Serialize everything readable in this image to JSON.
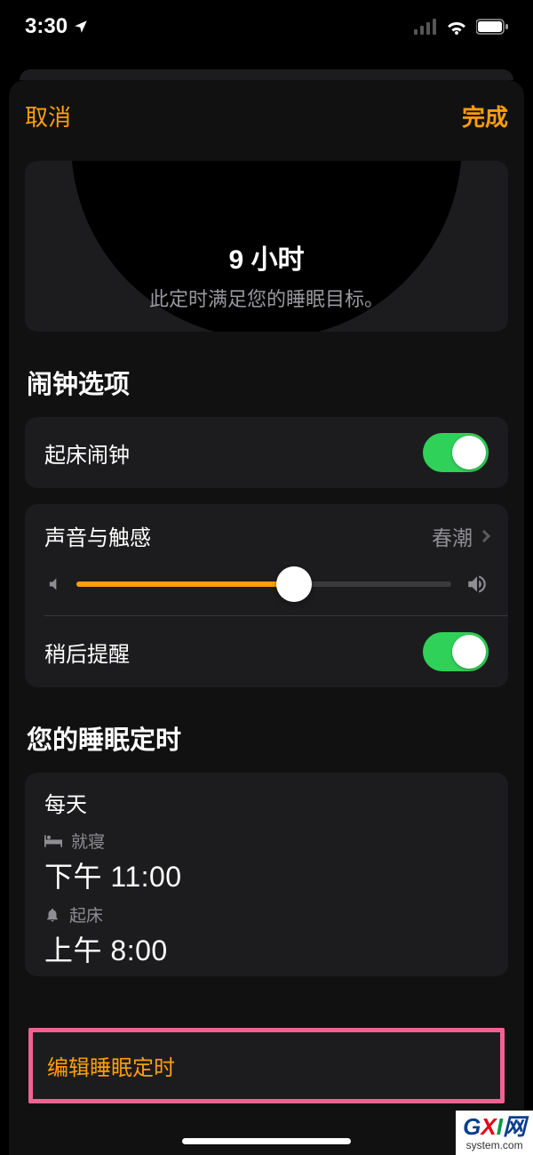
{
  "status": {
    "time": "3:30"
  },
  "nav": {
    "cancel": "取消",
    "done": "完成"
  },
  "summary": {
    "title": "9 小时",
    "subtitle": "此定时满足您的睡眠目标。"
  },
  "alarm_section": {
    "title": "闹钟选项",
    "wake_alarm_label": "起床闹钟",
    "sound_label": "声音与触感",
    "sound_value": "春潮",
    "snooze_label": "稍后提醒"
  },
  "schedule_section": {
    "title": "您的睡眠定时",
    "freq": "每天",
    "bed_label": "就寝",
    "bed_time": "下午 11:00",
    "wake_label": "起床",
    "wake_time": "上午 8:00",
    "edit": "编辑睡眠定时"
  },
  "watermark": {
    "brand_g": "G",
    "brand_x": "X",
    "brand_i": "I",
    "brand_suffix": "网",
    "domain": "system.com"
  }
}
